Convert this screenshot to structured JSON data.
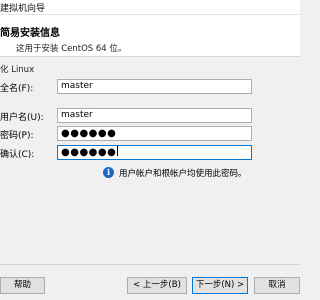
{
  "window": {
    "title": "建拟机向导"
  },
  "header": {
    "heading": "简易安装信息",
    "subtitle": "这用于安装 CentOS 64 位。"
  },
  "section": {
    "title": "化 Linux"
  },
  "fields": {
    "fullname": {
      "label": "全名(F):",
      "value": "master"
    },
    "username": {
      "label": "用户名(U):",
      "value": "master"
    },
    "password": {
      "label": "密码(P):",
      "value": "●●●●●●"
    },
    "confirm": {
      "label": "确认(C):",
      "value": "●●●●●●"
    }
  },
  "info": {
    "text": "用户帐户和根帐户均使用此密码。"
  },
  "buttons": {
    "help": "帮助",
    "back": "< 上一步(B)",
    "next": "下一步(N) >",
    "cancel": "取消"
  }
}
